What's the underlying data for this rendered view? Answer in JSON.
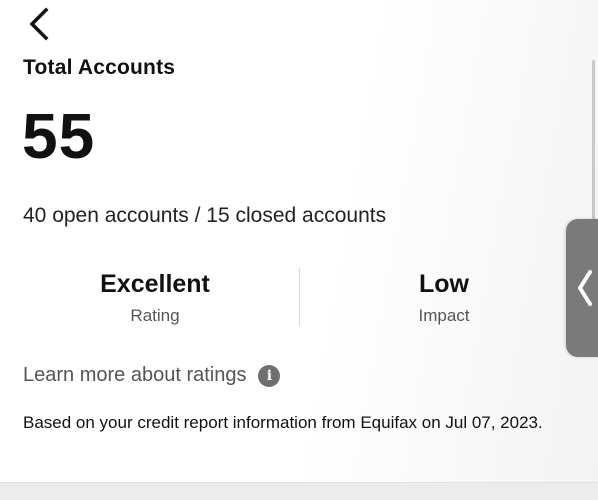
{
  "header": {
    "back_icon": "chevron-left-icon"
  },
  "accounts": {
    "title": "Total Accounts",
    "total": "55",
    "summary": "40 open accounts / 15 closed accounts"
  },
  "stats": [
    {
      "value": "Excellent",
      "label": "Rating"
    },
    {
      "value": "Low",
      "label": "Impact"
    }
  ],
  "learn_more": {
    "label": "Learn more about ratings",
    "icon": "info-icon",
    "icon_glyph": "i"
  },
  "footnote": "Based on your credit report information from Equifax on Jul 07, 2023.",
  "side_handle": {
    "icon": "chevron-left-icon"
  },
  "colors": {
    "text": "#111111",
    "muted": "#555555",
    "handle": "#7a7a7a"
  }
}
